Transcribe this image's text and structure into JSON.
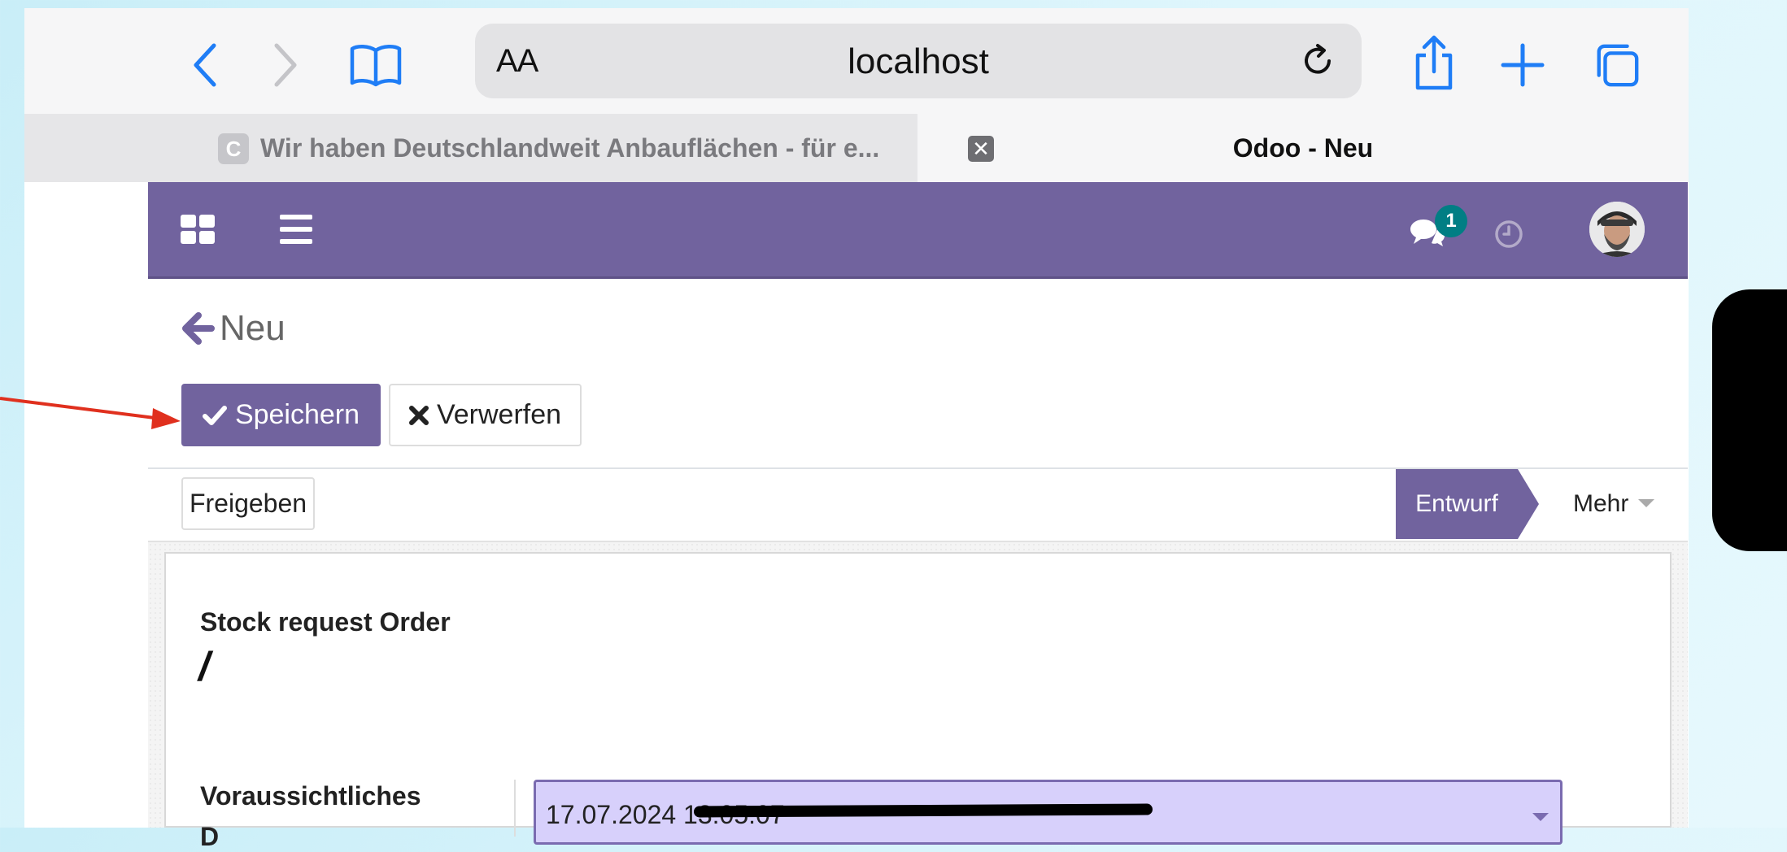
{
  "browser": {
    "url_prefix": "AA",
    "url": "localhost",
    "tabs": [
      {
        "favicon": "C",
        "title": "Wir haben Deutschlandweit Anbauflächen - für e...",
        "active": false
      },
      {
        "title": "Odoo - Neu",
        "active": true
      }
    ]
  },
  "odoo": {
    "navbar": {
      "messages_badge": "1"
    },
    "breadcrumb": "Neu",
    "buttons": {
      "save": "Speichern",
      "discard": "Verwerfen"
    },
    "statusbar": {
      "release": "Freigeben",
      "stage": "Entwurf",
      "more": "Mehr"
    },
    "form": {
      "title_label": "Stock request Order",
      "name_value": "/",
      "field_label_line1": "Voraussichtliches",
      "field_label_line2": "D",
      "date_value": "17.07.2024 13:05:07"
    }
  },
  "colors": {
    "brand": "#71639e",
    "badge": "#017e84",
    "annotation_arrow": "#e0301e",
    "ios_blue": "#1f7df6"
  }
}
